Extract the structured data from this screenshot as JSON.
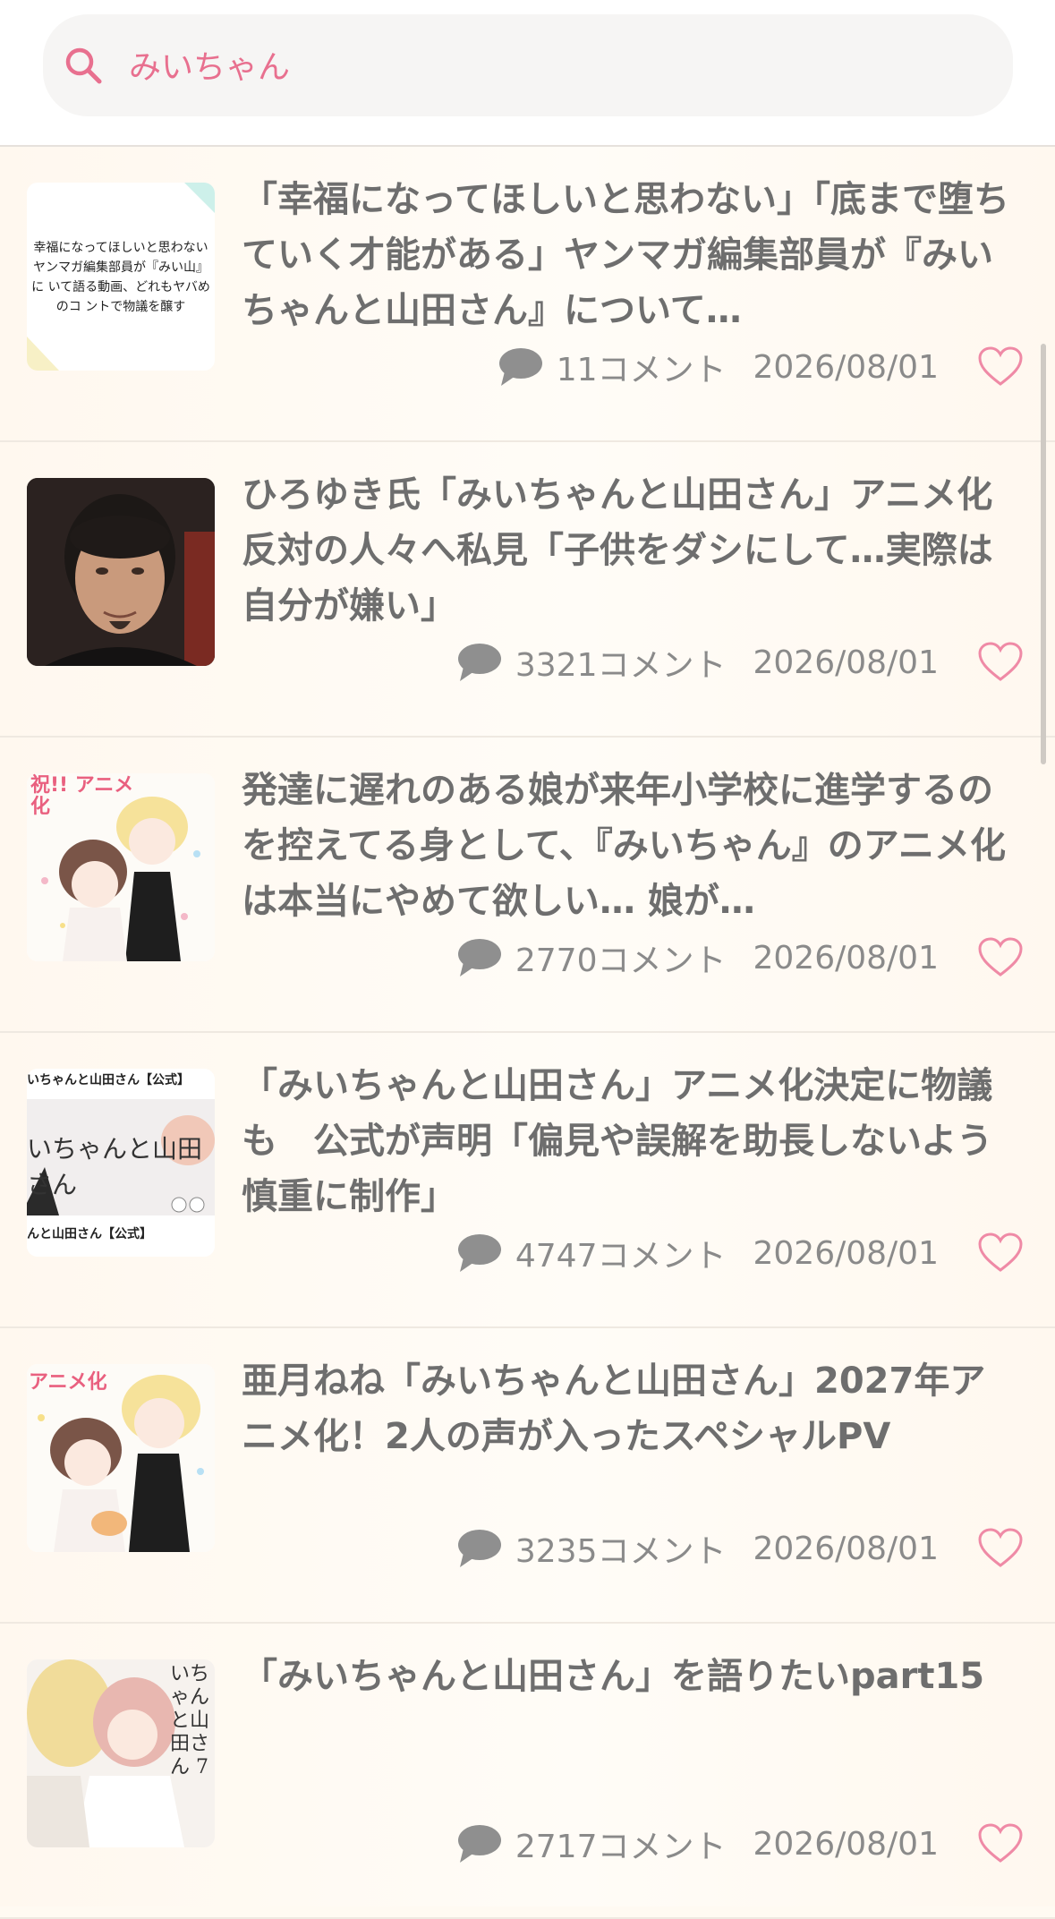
{
  "search": {
    "query": "みいちゃん",
    "icon": "search-icon",
    "accent": "#e8708f"
  },
  "articles": [
    {
      "title": "「幸福になってほしいと思わない」「底まで堕ちていく才能がある」ヤンマガ編集部員が『みいちゃんと山田さん』について…",
      "comments": "11コメント",
      "date": "2026/08/01",
      "thumb_text": "幸福になってほしいと思わない ヤンマガ編集部員が『みい山』に いて語る動画、どれもヤバめのコ ントで物議を醸す"
    },
    {
      "title": "ひろゆき氏「みいちゃんと山田さん」アニメ化反対の人々へ私見「子供をダシにして…実際は自分が嫌い」",
      "comments": "3321コメント",
      "date": "2026/08/01"
    },
    {
      "title": "発達に遅れのある娘が来年小学校に進学するのを控えてる身として、『みいちゃん』のアニメ化は本当にやめて欲しい… 娘が…",
      "comments": "2770コメント",
      "date": "2026/08/01",
      "thumb_text": "祝!! アニメ化"
    },
    {
      "title": "「みいちゃんと山田さん」アニメ化決定に物議も　公式が声明「偏見や誤解を助長しないよう慎重に制作」",
      "comments": "4747コメント",
      "date": "2026/08/01",
      "thumb_text_top": "いちゃんと山田さん【公式】",
      "thumb_text_mid": "いちゃんと山田さん",
      "thumb_text_bottom": "んと山田さん【公式】"
    },
    {
      "title": "亜月ねね「みいちゃんと山田さん」2027年アニメ化！2人の声が入ったスペシャルPV",
      "comments": "3235コメント",
      "date": "2026/08/01",
      "thumb_text": "アニメ化"
    },
    {
      "title": "「みいちゃんと山田さん」を語りたいpart15",
      "comments": "2717コメント",
      "date": "2026/08/01",
      "thumb_text": "いちゃんと山田さん 7"
    }
  ],
  "icons": {
    "comment": "comment-icon",
    "favorite": "heart-icon"
  },
  "colors": {
    "heart": "#ef8aa6",
    "meta": "#8a8a8a",
    "title": "#6e6e6e"
  }
}
